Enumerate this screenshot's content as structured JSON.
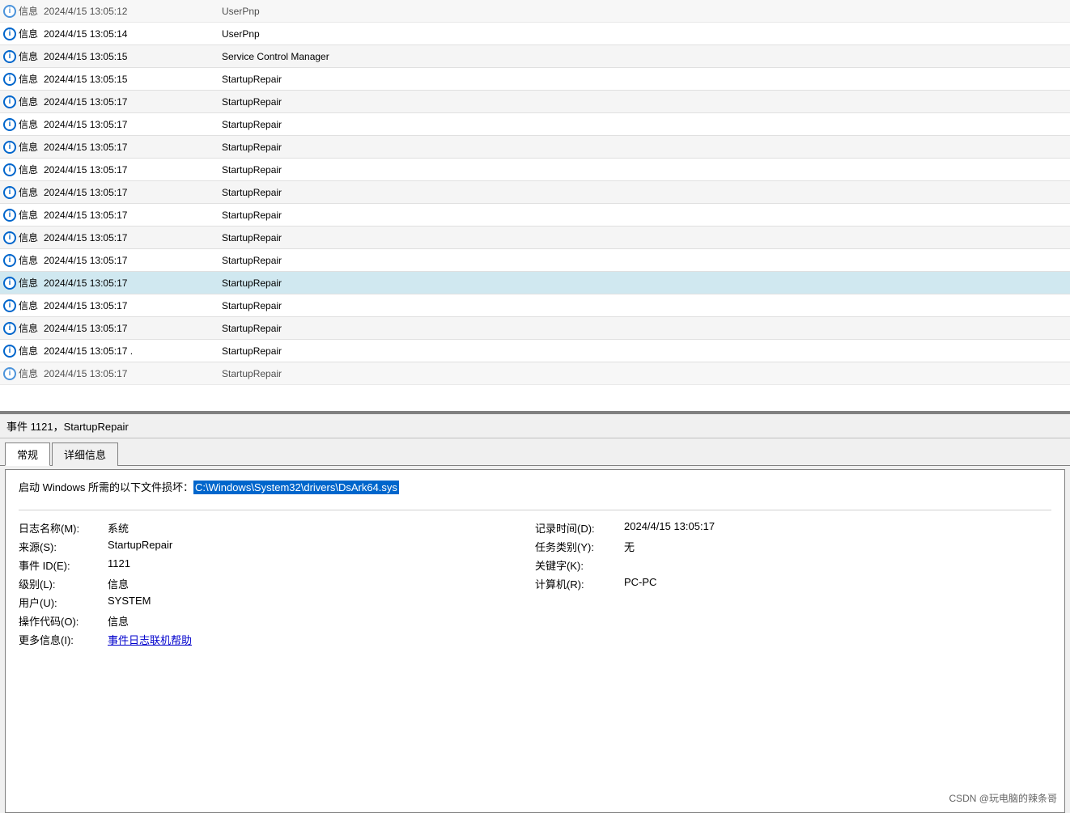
{
  "logRows": [
    {
      "type": "信息",
      "datetime": "2024/4/15 13:05:12",
      "source": "UserPnp",
      "highlighted": false,
      "partial": true
    },
    {
      "type": "信息",
      "datetime": "2024/4/15 13:05:14",
      "source": "UserPnp",
      "highlighted": false,
      "partial": false
    },
    {
      "type": "信息",
      "datetime": "2024/4/15 13:05:15",
      "source": "Service Control Manager",
      "highlighted": false,
      "partial": false
    },
    {
      "type": "信息",
      "datetime": "2024/4/15 13:05:15",
      "source": "StartupRepair",
      "highlighted": false,
      "partial": false
    },
    {
      "type": "信息",
      "datetime": "2024/4/15 13:05:17",
      "source": "StartupRepair",
      "highlighted": false,
      "partial": false
    },
    {
      "type": "信息",
      "datetime": "2024/4/15 13:05:17",
      "source": "StartupRepair",
      "highlighted": false,
      "partial": false
    },
    {
      "type": "信息",
      "datetime": "2024/4/15 13:05:17",
      "source": "StartupRepair",
      "highlighted": false,
      "partial": false
    },
    {
      "type": "信息",
      "datetime": "2024/4/15 13:05:17",
      "source": "StartupRepair",
      "highlighted": false,
      "partial": false
    },
    {
      "type": "信息",
      "datetime": "2024/4/15 13:05:17",
      "source": "StartupRepair",
      "highlighted": false,
      "partial": false
    },
    {
      "type": "信息",
      "datetime": "2024/4/15 13:05:17",
      "source": "StartupRepair",
      "highlighted": false,
      "partial": false
    },
    {
      "type": "信息",
      "datetime": "2024/4/15 13:05:17",
      "source": "StartupRepair",
      "highlighted": false,
      "partial": false
    },
    {
      "type": "信息",
      "datetime": "2024/4/15 13:05:17",
      "source": "StartupRepair",
      "highlighted": false,
      "partial": false
    },
    {
      "type": "信息",
      "datetime": "2024/4/15 13:05:17",
      "source": "StartupRepair",
      "highlighted": true,
      "partial": false
    },
    {
      "type": "信息",
      "datetime": "2024/4/15 13:05:17",
      "source": "StartupRepair",
      "highlighted": false,
      "partial": false
    },
    {
      "type": "信息",
      "datetime": "2024/4/15 13:05:17",
      "source": "StartupRepair",
      "highlighted": false,
      "partial": false
    },
    {
      "type": "信息",
      "datetime": "2024/4/15 13:05:17 .",
      "source": "StartupRepair",
      "highlighted": false,
      "partial": false
    },
    {
      "type": "信息",
      "datetime": "2024/4/15 13:05:17",
      "source": "StartupRepair",
      "highlighted": false,
      "partial": true
    }
  ],
  "eventTitle": "事件 1121，StartupRepair",
  "tabs": [
    {
      "label": "常规",
      "active": true
    },
    {
      "label": "详细信息",
      "active": false
    }
  ],
  "description_prefix": "启动 Windows 所需的以下文件损坏：",
  "description_path": "C:\\Windows\\System32\\drivers\\DsArk64.sys",
  "properties": {
    "left": [
      {
        "label": "日志名称(M):",
        "value": "系统"
      },
      {
        "label": "来源(S):",
        "value": "StartupRepair"
      },
      {
        "label": "事件 ID(E):",
        "value": "1121"
      },
      {
        "label": "级别(L):",
        "value": "信息"
      },
      {
        "label": "用户(U):",
        "value": "SYSTEM"
      },
      {
        "label": "操作代码(O):",
        "value": "信息"
      },
      {
        "label": "更多信息(I):",
        "value": "事件日志联机帮助",
        "isLink": true
      }
    ],
    "right": [
      {
        "label": "记录时间(D):",
        "value": "2024/4/15 13:05:17"
      },
      {
        "label": "任务类别(Y):",
        "value": "无"
      },
      {
        "label": "关键字(K):",
        "value": ""
      },
      {
        "label": "计算机(R):",
        "value": "PC-PC"
      }
    ]
  },
  "watermark": "CSDN @玩电脑的辣条哥"
}
